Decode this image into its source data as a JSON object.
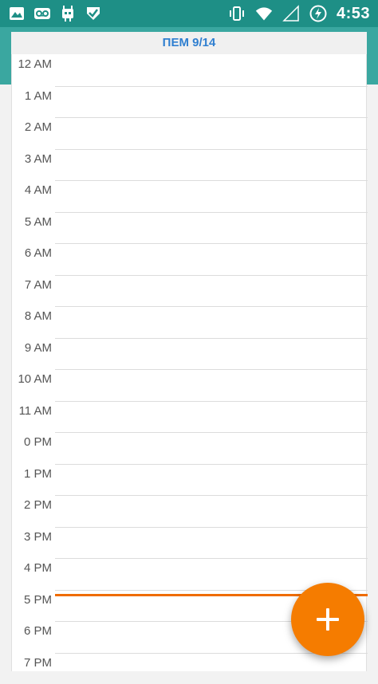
{
  "status_bar": {
    "time": "4:53",
    "left_icons": [
      "image-icon",
      "voicemail-icon",
      "android-icon",
      "check-badge-icon"
    ],
    "right_icons": [
      "vibrate-icon",
      "wifi-icon",
      "signal-icon",
      "battery-charging-icon"
    ]
  },
  "header": {
    "day_label": "ПЕМ 9/14"
  },
  "calendar": {
    "hours": [
      "12 AM",
      "1 AM",
      "2 AM",
      "3 AM",
      "4 AM",
      "5 AM",
      "6 AM",
      "7 AM",
      "8 AM",
      "9 AM",
      "10 AM",
      "11 AM",
      "0 PM",
      "1 PM",
      "2 PM",
      "3 PM",
      "4 PM",
      "5 PM",
      "6 PM",
      "7 PM"
    ]
  },
  "colors": {
    "status_bar": "#1e8f86",
    "app_bar": "#3aa7a0",
    "header_text": "#2f7fd0",
    "accent": "#f57c00",
    "now_line": "#ef6c00"
  },
  "fab": {
    "icon": "plus-icon"
  }
}
